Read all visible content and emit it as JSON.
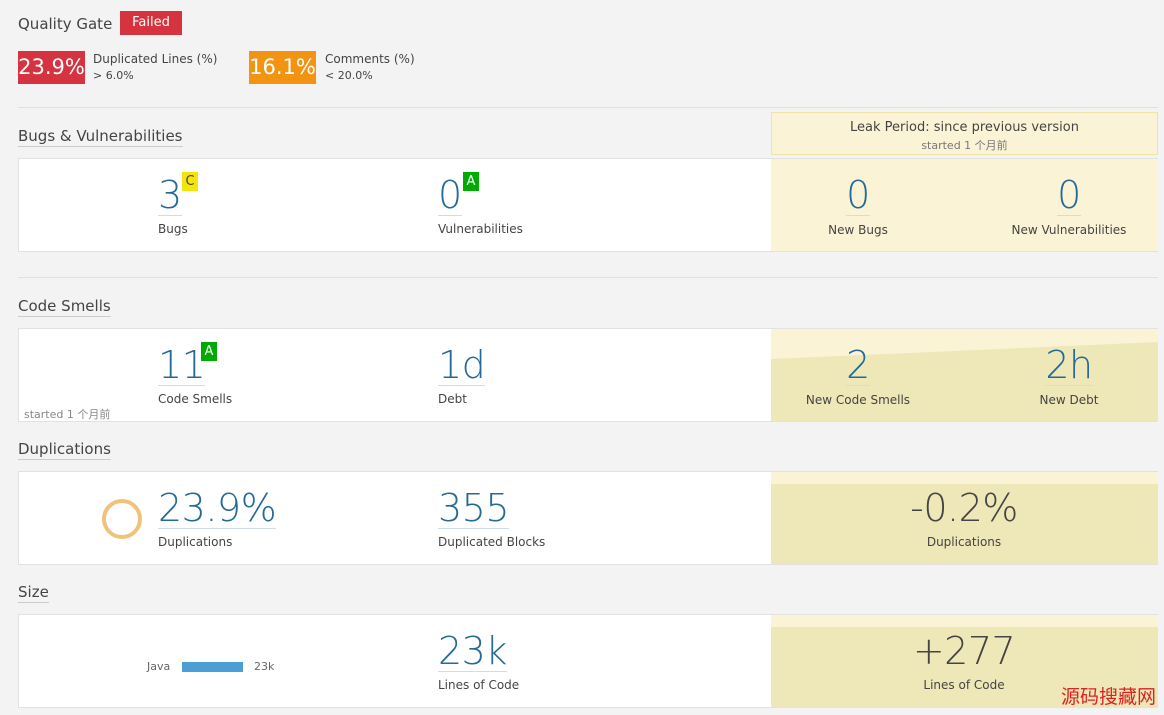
{
  "quality_gate": {
    "title": "Quality Gate",
    "status": "Failed",
    "conditions": [
      {
        "value": "23.9%",
        "name": "Duplicated Lines (%)",
        "threshold": "> 6.0%",
        "color": "#d4333f"
      },
      {
        "value": "16.1%",
        "name": "Comments (%)",
        "threshold": "< 20.0%",
        "color": "#f29312"
      }
    ]
  },
  "leak_period": {
    "title": "Leak Period: since previous version",
    "started": "started 1 个月前"
  },
  "bugs_vulns": {
    "title": "Bugs & Vulnerabilities",
    "bugs": {
      "value": "3",
      "label": "Bugs",
      "rating": "C"
    },
    "vulnerabilities": {
      "value": "0",
      "label": "Vulnerabilities",
      "rating": "A"
    },
    "new_bugs": {
      "value": "0",
      "label": "New Bugs"
    },
    "new_vulnerabilities": {
      "value": "0",
      "label": "New Vulnerabilities"
    }
  },
  "code_smells": {
    "title": "Code Smells",
    "smells": {
      "value": "11",
      "label": "Code Smells",
      "rating": "A"
    },
    "debt": {
      "value": "1d",
      "label": "Debt"
    },
    "started": "started 1 个月前",
    "new_smells": {
      "value": "2",
      "label": "New Code Smells"
    },
    "new_debt": {
      "value": "2h",
      "label": "New Debt"
    }
  },
  "duplications": {
    "title": "Duplications",
    "density": {
      "value": "23.9%",
      "label": "Duplications"
    },
    "blocks": {
      "value": "355",
      "label": "Duplicated Blocks"
    },
    "new_density": {
      "value": "-0.2%",
      "label": "Duplications"
    }
  },
  "size": {
    "title": "Size",
    "language": {
      "name": "Java",
      "value": "23k"
    },
    "lines": {
      "value": "23k",
      "label": "Lines of Code"
    },
    "new_lines": {
      "value": "+277",
      "label": "Lines of Code"
    }
  },
  "watermark": "源码搜藏网",
  "colors": {
    "error": "#d4333f",
    "warn": "#f29312",
    "rating_a": "#00aa00",
    "rating_c": "#f4e40b",
    "leak": "#eee7b7",
    "link": "#236a97"
  }
}
